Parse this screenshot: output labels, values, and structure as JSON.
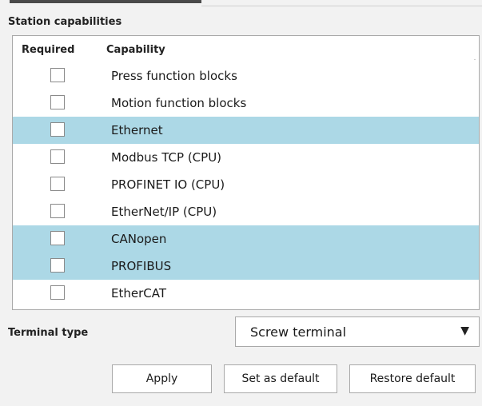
{
  "section_title": "Station capabilities",
  "table": {
    "columns": [
      "Required",
      "Capability"
    ],
    "rows": [
      {
        "capability": "Press function blocks",
        "required": false,
        "highlighted": false
      },
      {
        "capability": "Motion function blocks",
        "required": false,
        "highlighted": false
      },
      {
        "capability": "Ethernet",
        "required": false,
        "highlighted": true
      },
      {
        "capability": "Modbus TCP (CPU)",
        "required": false,
        "highlighted": false
      },
      {
        "capability": "PROFINET IO (CPU)",
        "required": false,
        "highlighted": false
      },
      {
        "capability": "EtherNet/IP (CPU)",
        "required": false,
        "highlighted": false
      },
      {
        "capability": "CANopen",
        "required": false,
        "highlighted": true
      },
      {
        "capability": "PROFIBUS",
        "required": false,
        "highlighted": true
      },
      {
        "capability": "EtherCAT",
        "required": false,
        "highlighted": false
      }
    ]
  },
  "terminal": {
    "label": "Terminal type",
    "selected": "Screw terminal",
    "arrow_icon": "dropdown-arrow-icon"
  },
  "buttons": {
    "apply": "Apply",
    "set_default": "Set as default",
    "restore_default": "Restore default"
  },
  "colors": {
    "highlight_row": "#acd8e6",
    "panel_background": "#f2f2f2"
  }
}
